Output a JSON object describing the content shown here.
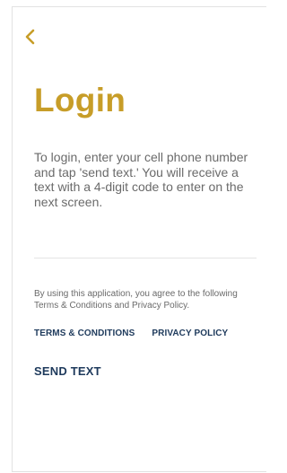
{
  "header": {
    "back_icon": "chevron-left-icon"
  },
  "login": {
    "title": "Login",
    "intro": "To login, enter your cell phone number and tap 'send text.' You will receive a text with a 4-digit code to enter on the next screen.",
    "agreement": "By using this application, you agree to the following Terms & Conditions and Privacy Policy.",
    "terms_label": "TERMS & CONDITIONS",
    "privacy_label": "PRIVACY POLICY",
    "send_text_label": "SEND TEXT"
  },
  "colors": {
    "accent_gold": "#c79d28",
    "link_navy": "#1e3a5c",
    "body_text": "#6a6a6a"
  }
}
